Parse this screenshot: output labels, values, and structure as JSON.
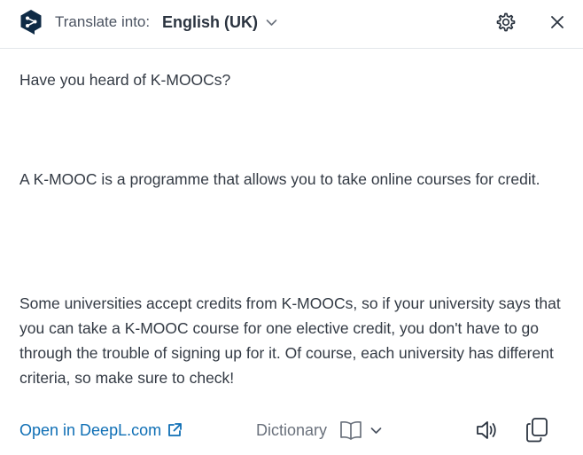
{
  "header": {
    "translate_label": "Translate into:",
    "target_language": "English (UK)",
    "icons": {
      "logo": "deepl-logo-icon",
      "settings": "gear-icon",
      "close": "close-icon",
      "chevron": "chevron-down-icon"
    }
  },
  "translation": {
    "paragraphs": [
      "Have you heard of K-MOOCs?",
      "A K-MOOC is a programme that allows you to take online courses for credit.",
      "Some universities accept credits from K-MOOCs, so if your university says that you can take a K-MOOC course for one elective credit, you don't have to go through the trouble of signing up for it. Of course, each university has different criteria, so make sure to check!"
    ]
  },
  "footer": {
    "open_link_label": "Open in DeepL.com",
    "dictionary_label": "Dictionary",
    "icons": {
      "external": "external-link-icon",
      "dictionary": "book-icon",
      "chevron": "chevron-down-icon",
      "speak": "speaker-icon",
      "copy": "copy-icon"
    }
  },
  "colors": {
    "link": "#0f6fb5",
    "text": "#333a44",
    "logo": "#0f2b46",
    "divider": "#e3e6ea"
  }
}
